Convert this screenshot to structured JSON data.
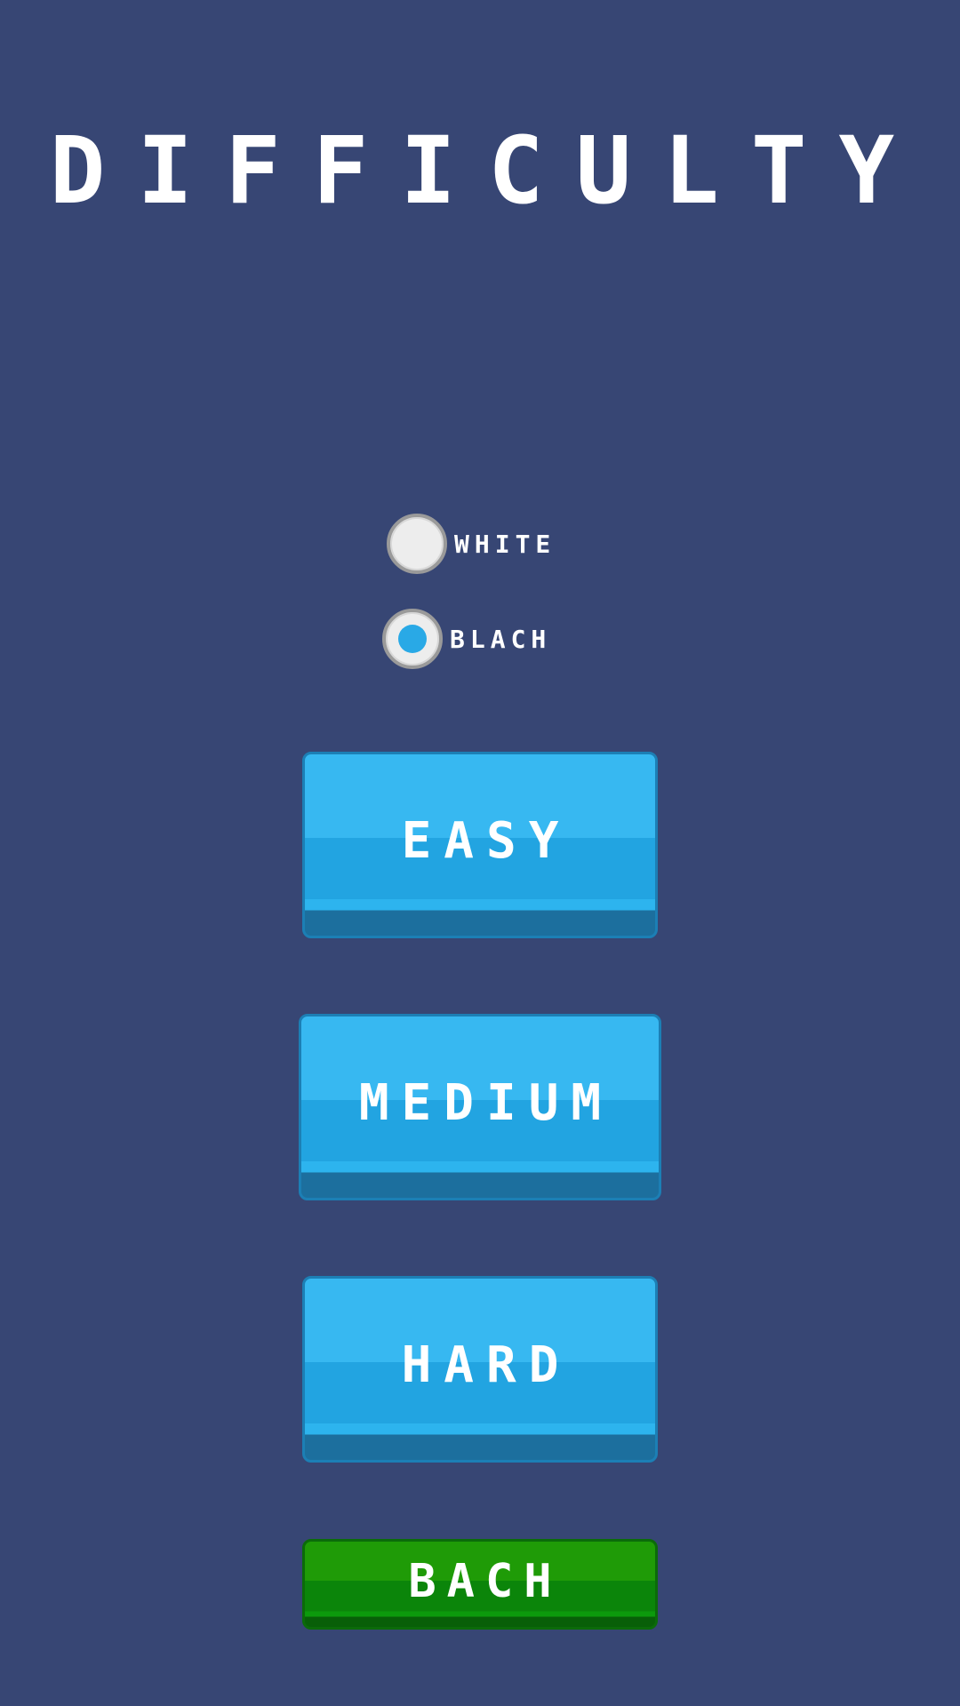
{
  "screen": {
    "title": "DIFFICULTY",
    "background_color": "#374674"
  },
  "color_options": [
    {
      "label": "WHITE",
      "selected": false
    },
    {
      "label": "BLACH",
      "selected": true
    }
  ],
  "difficulty_buttons": {
    "easy": "EASY",
    "medium": "MEDIUM",
    "hard": "HARD"
  },
  "back_button": {
    "label": "BACH"
  },
  "colors": {
    "button_blue": "#37b8f1",
    "button_green": "#1f9b07",
    "radio_accent": "#29a9e6",
    "text": "#ffffff"
  }
}
